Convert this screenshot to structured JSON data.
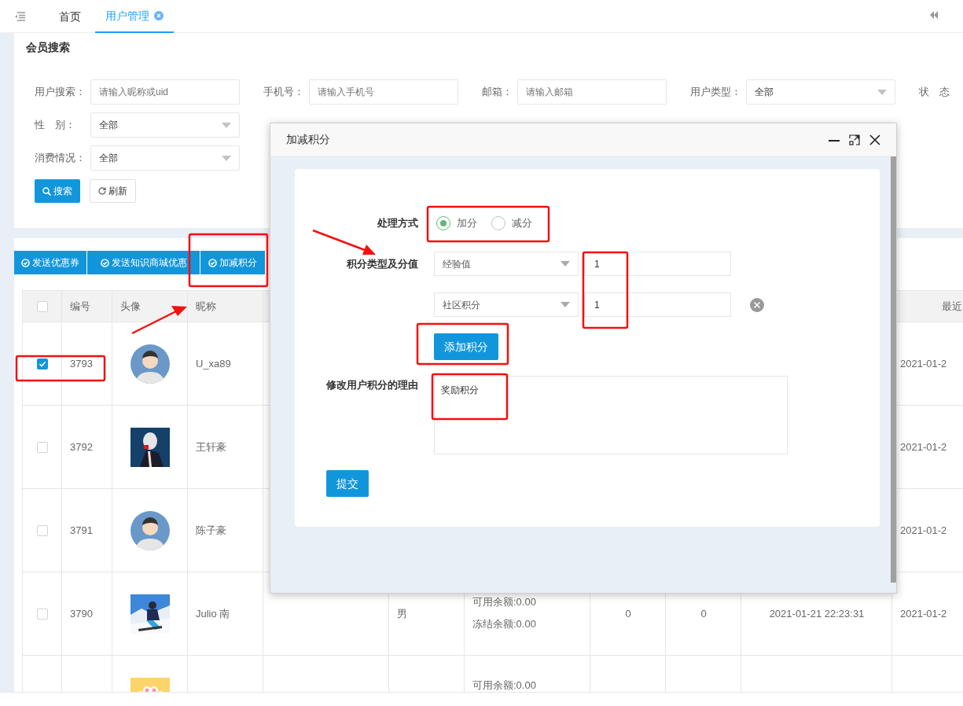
{
  "tabs": [
    {
      "label": "首页",
      "selected": false,
      "closable": false
    },
    {
      "label": "用户管理",
      "selected": true,
      "closable": true
    }
  ],
  "search": {
    "title": "会员搜索",
    "rows": [
      [
        {
          "label": "用户搜索：",
          "kind": "input",
          "placeholder": "请输入昵称或uid"
        },
        {
          "label": "手机号：",
          "kind": "input",
          "placeholder": "请输入手机号"
        },
        {
          "label": "邮箱：",
          "kind": "input",
          "placeholder": "请输入邮箱"
        },
        {
          "label": "用户类型：",
          "kind": "select",
          "value": "全部"
        },
        {
          "label": "状　态",
          "kind": "cut"
        }
      ],
      [
        {
          "label": "性　别：",
          "kind": "select",
          "value": "全部"
        }
      ],
      [
        {
          "label": "消费情况：",
          "kind": "select",
          "value": "全部"
        }
      ]
    ],
    "buttons": [
      {
        "label": "搜索",
        "kind": "primary"
      },
      {
        "label": "刷新",
        "kind": "plain"
      }
    ]
  },
  "toolbar": [
    "发送优惠券",
    "发送知识商城优惠",
    "加减积分"
  ],
  "table": {
    "select_all_checked": false,
    "columns": [
      "编号",
      "头像",
      "昵称"
    ],
    "last_column": "最近",
    "rows": [
      {
        "checked": true,
        "id": "3793",
        "avatar": {
          "kind": "silhouette"
        },
        "nickname": "U_xa89",
        "last_visit": "2021-01-2"
      },
      {
        "checked": false,
        "id": "3792",
        "avatar": {
          "kind": "night"
        },
        "nickname": "王轩豪",
        "last_visit": "2021-01-2"
      },
      {
        "checked": false,
        "id": "3791",
        "avatar": {
          "kind": "silhouette"
        },
        "nickname": "陈子豪",
        "last_visit": "2021-01-2"
      },
      {
        "checked": false,
        "id": "3790",
        "avatar": {
          "kind": "snow"
        },
        "nickname": "Julio 南",
        "gender": "男",
        "balance": [
          "可用余额:0.00",
          "冻结余额:0.00"
        ],
        "column_8": "0",
        "column_9": "0",
        "created": "2021-01-21 22:23:31",
        "last_visit": "2021-01-2"
      },
      {
        "avatar": {
          "kind": "paw"
        },
        "balance": [
          "可用余额:0.00"
        ]
      }
    ]
  },
  "dialog": {
    "title": "加减积分",
    "mode_label": "处理方式",
    "modes": [
      {
        "label": "加分",
        "selected": true
      },
      {
        "label": "减分",
        "selected": false
      }
    ],
    "points_label": "积分类型及分值",
    "points": [
      {
        "type": "经验值",
        "value": "1",
        "removable": false
      },
      {
        "type": "社区积分",
        "value": "1",
        "removable": true
      }
    ],
    "add_button": "添加积分",
    "reason_label": "修改用户积分的理由",
    "reason": "奖励积分",
    "submit": "提交"
  }
}
